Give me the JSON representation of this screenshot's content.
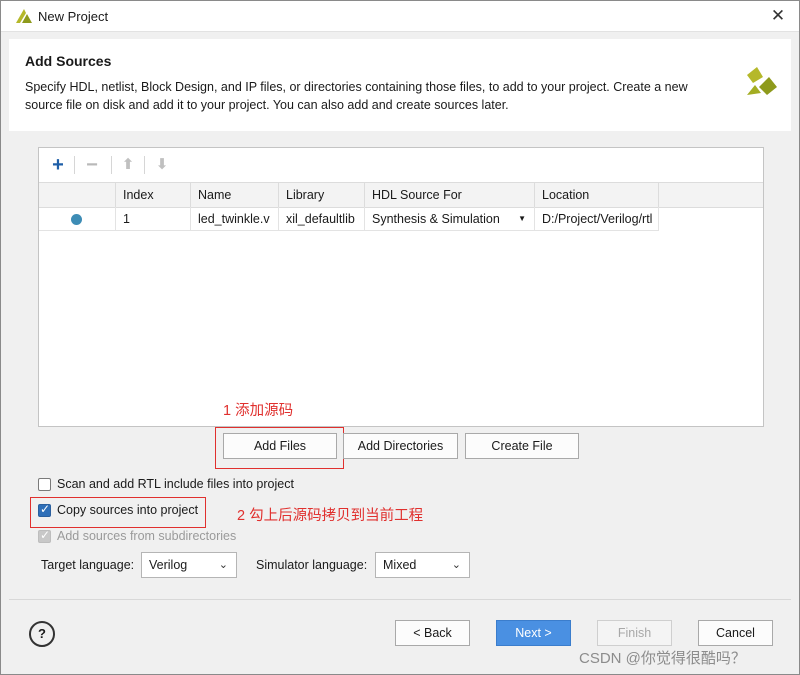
{
  "window": {
    "title": "New Project"
  },
  "header": {
    "title": "Add Sources",
    "description": "Specify HDL, netlist, Block Design, and IP files, or directories containing those files, to add to your project. Create a new source file on disk and add it to your project. You can also add and create sources later."
  },
  "toolbar": {
    "add": "+",
    "remove": "−",
    "up": "⬆",
    "down": "⬇"
  },
  "table": {
    "columns": [
      "",
      "Index",
      "Name",
      "Library",
      "HDL Source For",
      "Location"
    ],
    "rows": [
      {
        "index": "1",
        "name": "led_twinkle.v",
        "library": "xil_defaultlib",
        "hdl_source_for": "Synthesis & Simulation",
        "location": "D:/Project/Verilog/rtl"
      }
    ]
  },
  "buttons": {
    "add_files": "Add Files",
    "add_directories": "Add Directories",
    "create_file": "Create File"
  },
  "options": {
    "scan_rtl": "Scan and add RTL include files into project",
    "copy_sources": "Copy sources into project",
    "add_subdirs": "Add sources from subdirectories"
  },
  "language": {
    "target_label": "Target language:",
    "target_value": "Verilog",
    "simulator_label": "Simulator language:",
    "simulator_value": "Mixed"
  },
  "annotations": {
    "step1": "1 添加源码",
    "step2": "2 勾上后源码拷贝到当前工程"
  },
  "nav": {
    "help": "?",
    "back": "< Back",
    "next": "Next >",
    "finish": "Finish",
    "cancel": "Cancel"
  },
  "watermark": "CSDN @你觉得很酷吗？",
  "colors": {
    "accent": "#4a90e2",
    "annotation": "#e0302e",
    "status_dot": "#3d8cb5"
  }
}
